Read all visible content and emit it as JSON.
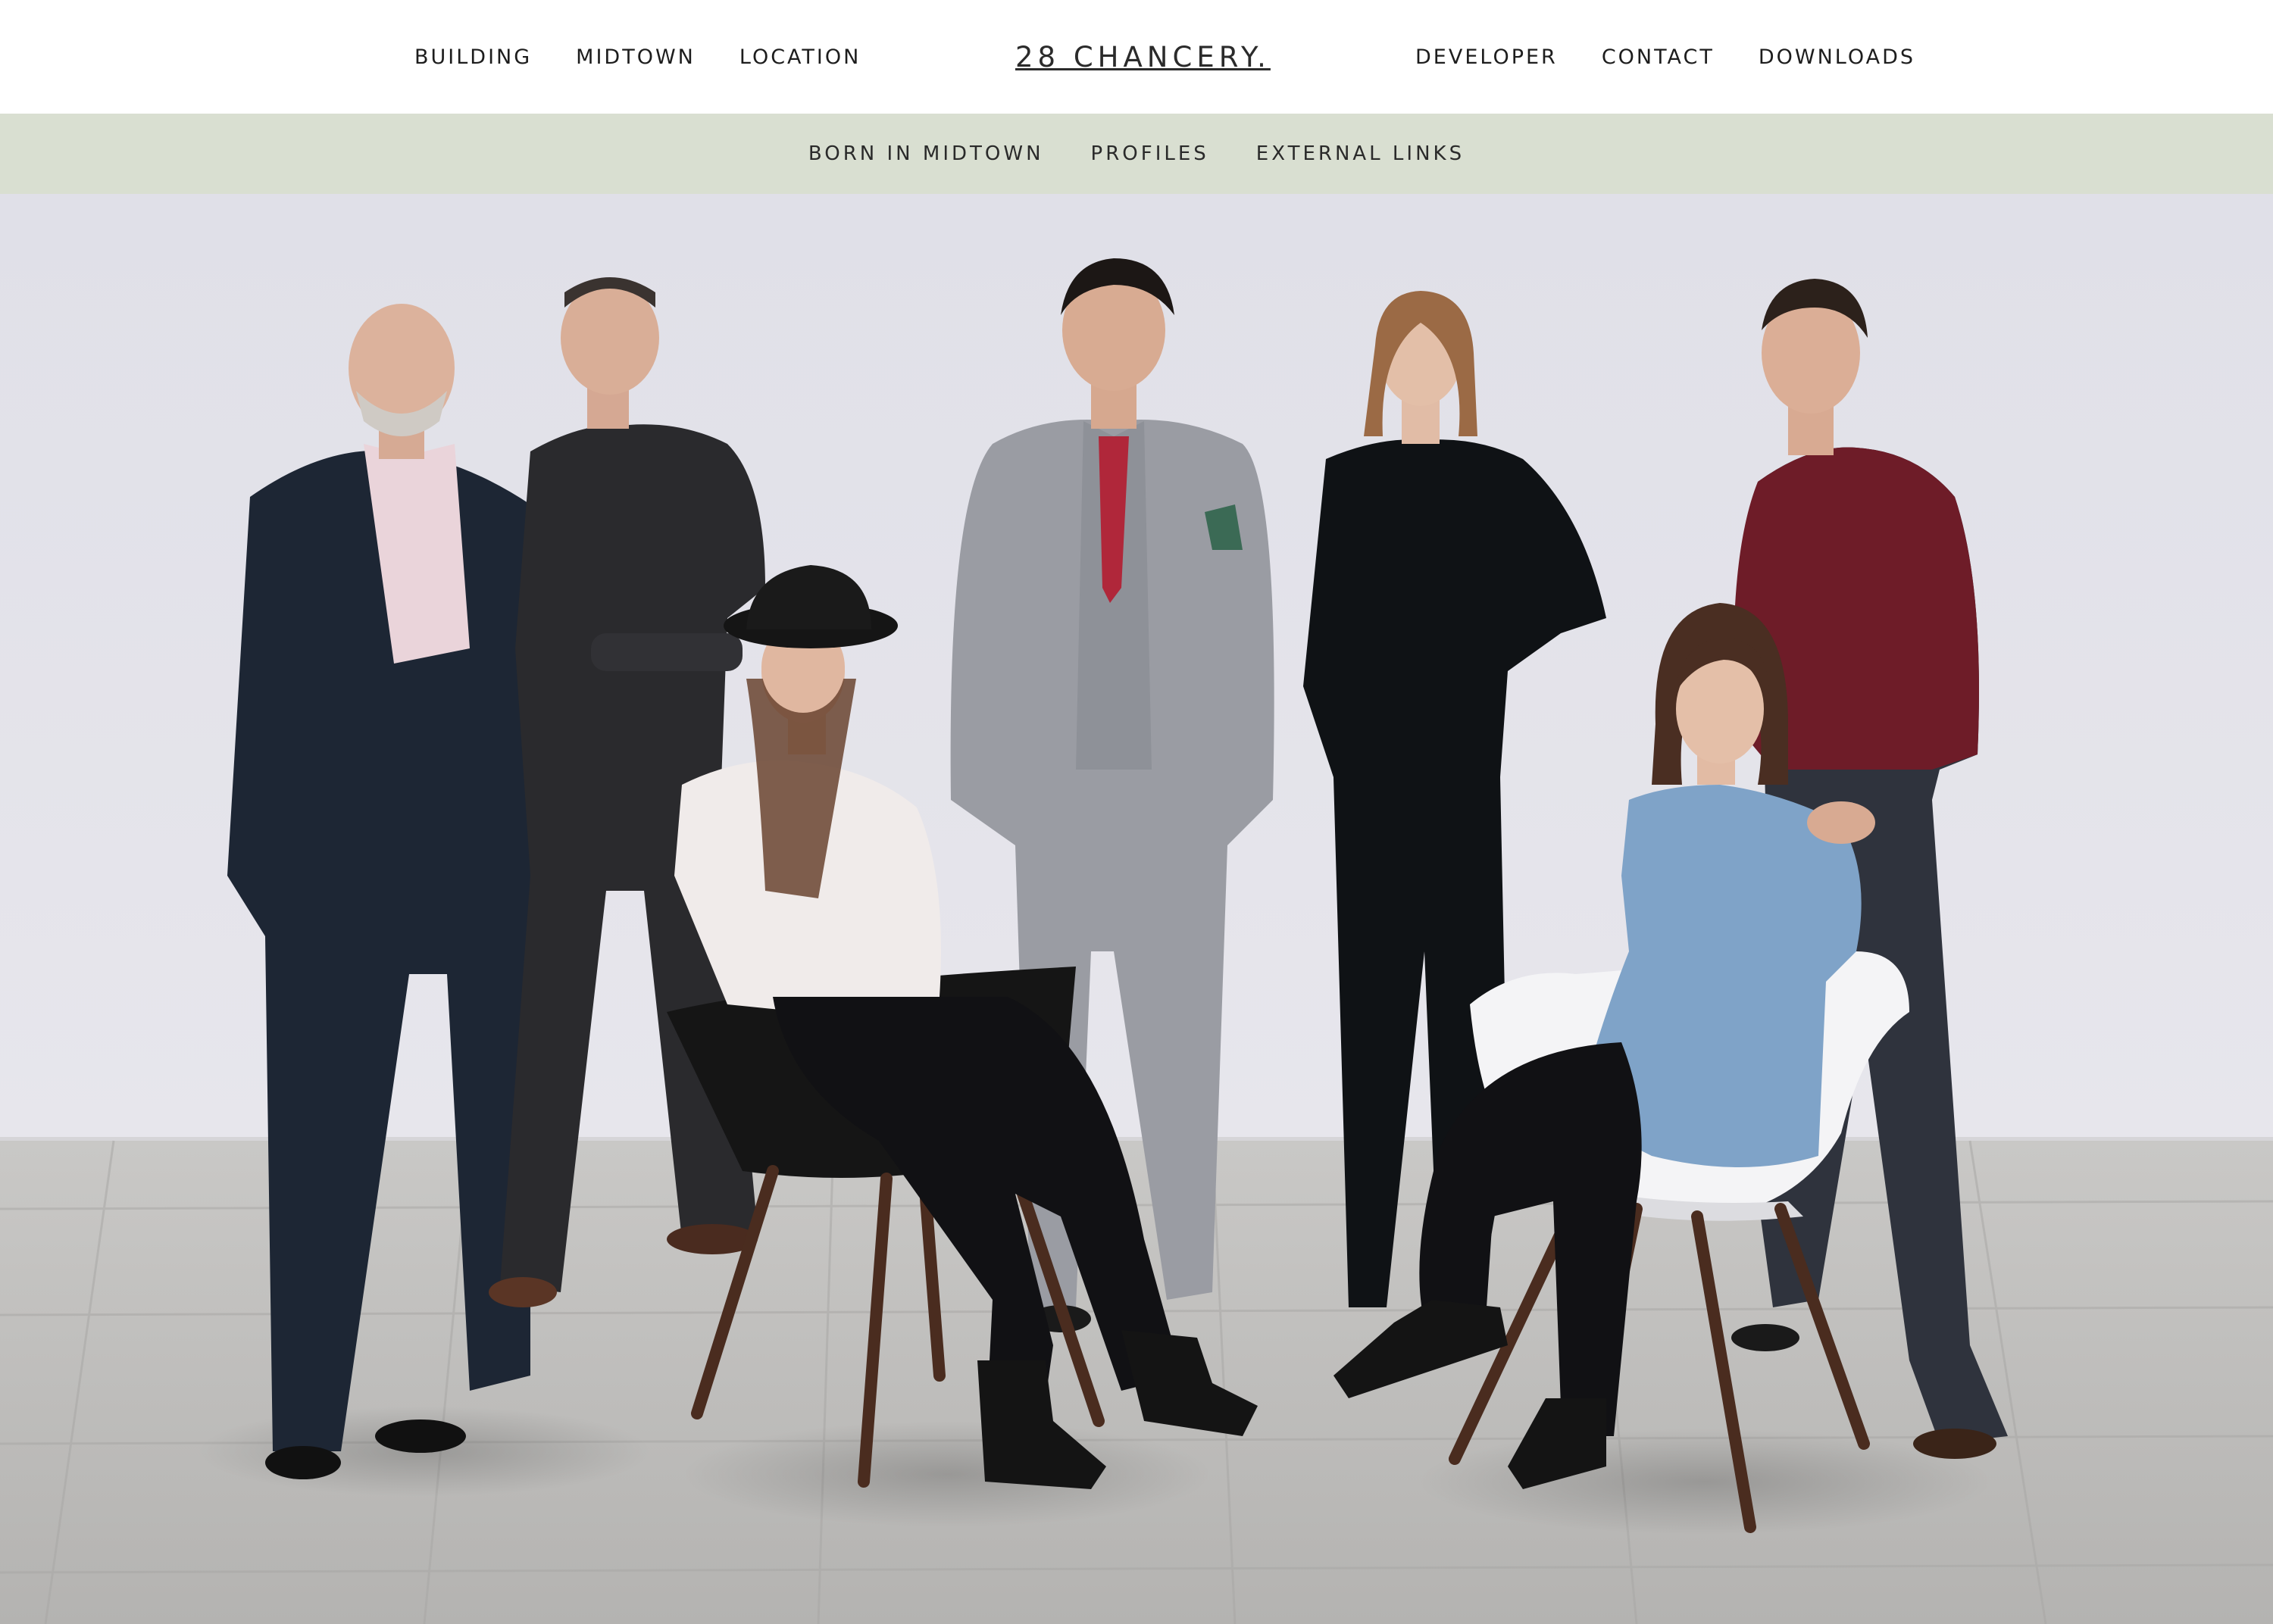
{
  "header": {
    "nav_left": [
      "BUILDING",
      "MIDTOWN",
      "LOCATION"
    ],
    "logo": "28 CHANCERY.",
    "nav_right": [
      "DEVELOPER",
      "CONTACT",
      "DOWNLOADS"
    ]
  },
  "subnav": {
    "items": [
      "BORN IN MIDTOWN",
      "PROFILES",
      "EXTERNAL LINKS"
    ]
  },
  "hero": {
    "image": "group-portrait-photo",
    "colors": {
      "wall": "#e3e3ea",
      "floor": "#b9b8b6",
      "subnav_bg": "#d9dfd1"
    }
  }
}
